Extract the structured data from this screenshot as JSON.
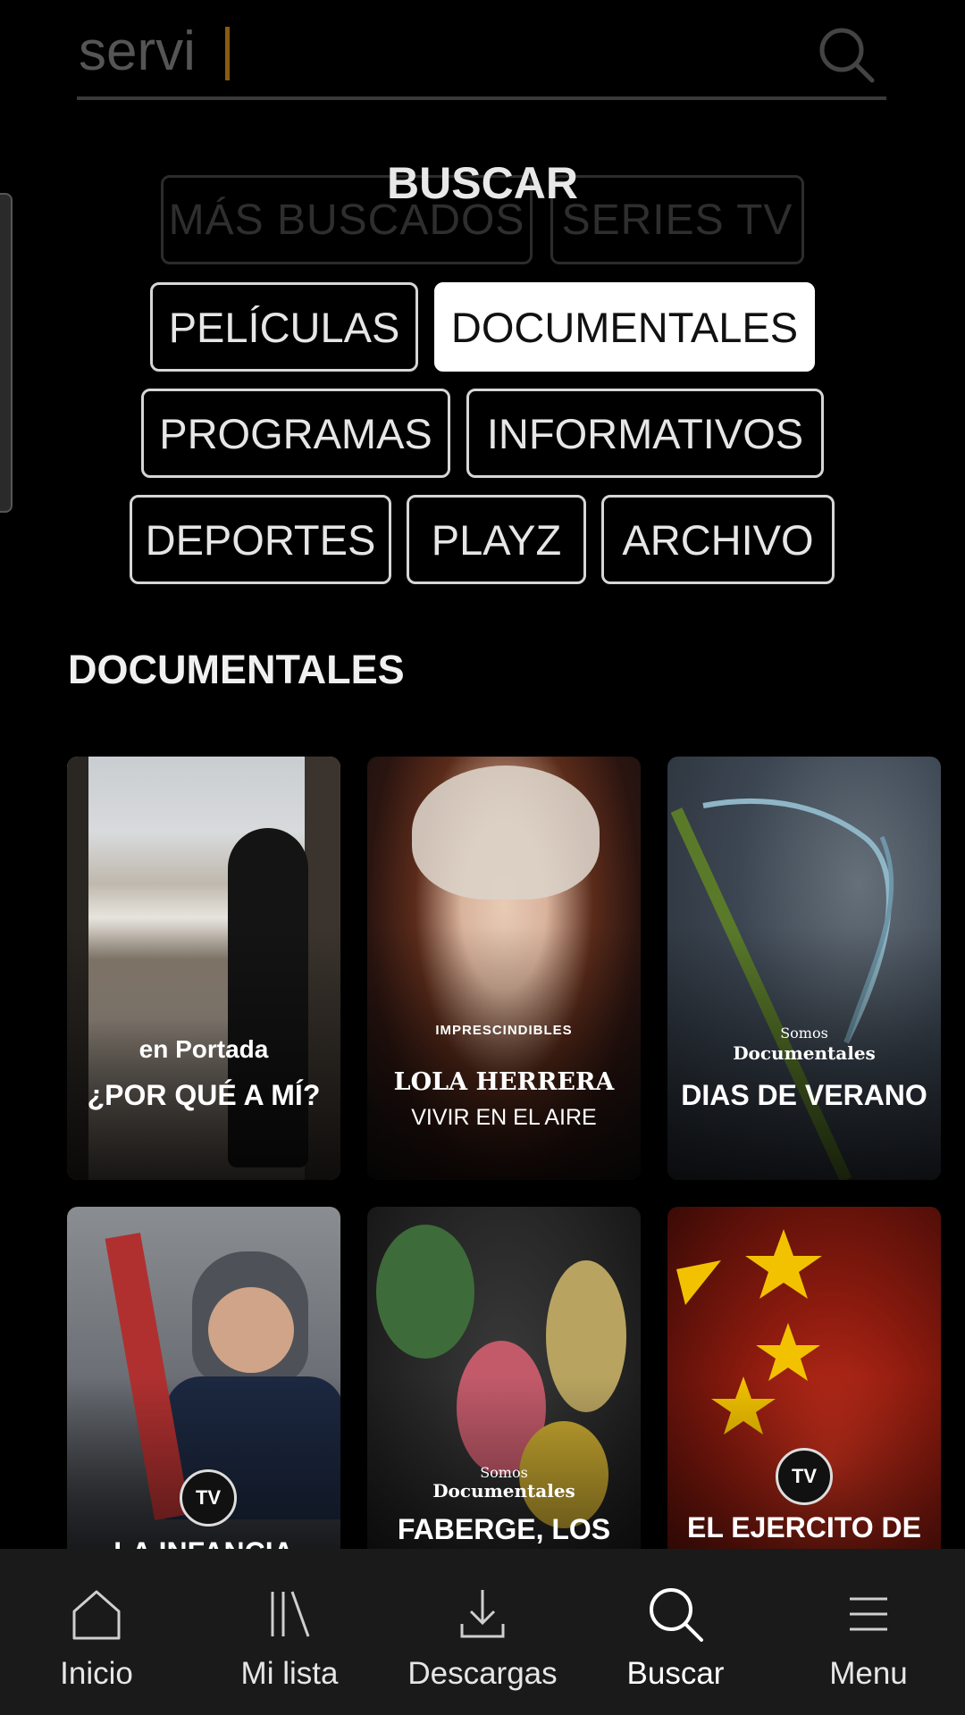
{
  "search": {
    "value": "servi"
  },
  "page_title": "BUSCAR",
  "ghost_chips": [
    "MÁS BUSCADOS",
    "SERIES TV"
  ],
  "chips": [
    {
      "label": "PELÍCULAS",
      "active": false
    },
    {
      "label": "DOCUMENTALES",
      "active": true
    },
    {
      "label": "PROGRAMAS",
      "active": false
    },
    {
      "label": "INFORMATIVOS",
      "active": false
    },
    {
      "label": "DEPORTES",
      "active": false
    },
    {
      "label": "PLAYZ",
      "active": false
    },
    {
      "label": "ARCHIVO",
      "active": false
    }
  ],
  "section_title": "DOCUMENTALES",
  "cards": [
    {
      "brand": "en Portada",
      "title": "¿POR QUÉ A MÍ?",
      "subtitle": ""
    },
    {
      "brand": "IMPRESCINDIBLES",
      "title": "LOLA HERRERA",
      "subtitle": "VIVIR EN EL AIRE"
    },
    {
      "brand_line1": "Somos",
      "brand_line2": "Documentales",
      "title": "DIAS DE VERANO"
    },
    {
      "title": "LA INFANCIA",
      "badge": "TV"
    },
    {
      "brand_line1": "Somos",
      "brand_line2": "Documentales",
      "title": "FABERGE, LOS OBJETOS DE"
    },
    {
      "title": "EL EJERCITO DE HACKERS DE",
      "badge": "TV"
    }
  ],
  "nav": [
    {
      "label": "Inicio",
      "icon": "home-icon"
    },
    {
      "label": "Mi lista",
      "icon": "library-icon"
    },
    {
      "label": "Descargas",
      "icon": "download-icon"
    },
    {
      "label": "Buscar",
      "icon": "search-icon",
      "current": true
    },
    {
      "label": "Menu",
      "icon": "menu-icon"
    }
  ]
}
